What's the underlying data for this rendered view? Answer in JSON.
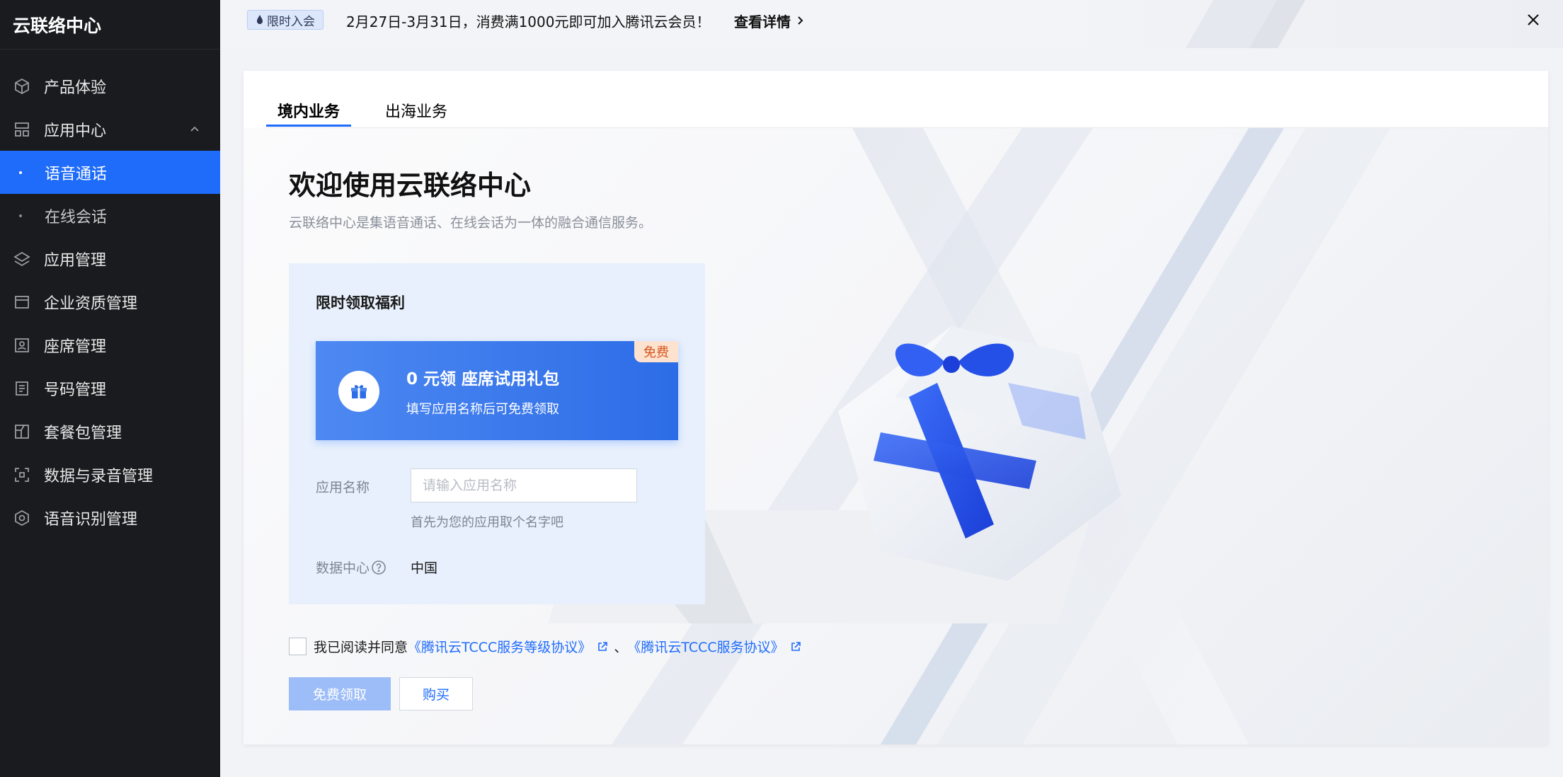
{
  "sidebar": {
    "title": "云联络中心",
    "items": [
      {
        "label": "产品体验",
        "icon": "cube-icon"
      },
      {
        "label": "应用中心",
        "icon": "grid-app-icon"
      },
      {
        "label": "语音通话",
        "sub": true,
        "active": true
      },
      {
        "label": "在线会话",
        "sub": true
      },
      {
        "label": "应用管理",
        "icon": "layers-icon"
      },
      {
        "label": "企业资质管理",
        "icon": "folder-icon"
      },
      {
        "label": "座席管理",
        "icon": "user-card-icon"
      },
      {
        "label": "号码管理",
        "icon": "document-icon"
      },
      {
        "label": "套餐包管理",
        "icon": "package-icon"
      },
      {
        "label": "数据与录音管理",
        "icon": "scan-icon"
      },
      {
        "label": "语音识别管理",
        "icon": "gear-hex-icon"
      }
    ]
  },
  "banner": {
    "tag": "限时入会",
    "text": "2月27日-3月31日，消费满1000元即可加入腾讯云会员！",
    "link": "查看详情"
  },
  "tabs": [
    {
      "label": "境内业务",
      "active": true
    },
    {
      "label": "出海业务"
    }
  ],
  "main": {
    "title": "欢迎使用云联络中心",
    "subtitle": "云联络中心是集语音通话、在线会话为一体的融合通信服务。"
  },
  "panel": {
    "title": "限时领取福利",
    "gift": {
      "badge": "免费",
      "title": "0 元领 座席试用礼包",
      "desc": "填写应用名称后可免费领取"
    },
    "app_name_label": "应用名称",
    "app_name_placeholder": "请输入应用名称",
    "app_name_value": "",
    "app_name_hint": "首先为您的应用取个名字吧",
    "data_center_label": "数据中心",
    "data_center_value": "中国"
  },
  "agreement": {
    "prefix": "我已阅读并同意",
    "link1": "《腾讯云TCCC服务等级协议》",
    "separator": "、",
    "link2": "《腾讯云TCCC服务协议》",
    "checked": false
  },
  "buttons": {
    "primary": "免费领取",
    "secondary": "购买"
  },
  "colors": {
    "accent": "#1f6cfb",
    "sidebar_bg": "#1a1b1e",
    "panel_bg": "#e8f0fd",
    "badge_bg": "#fde3cf",
    "badge_text": "#d6541f"
  }
}
